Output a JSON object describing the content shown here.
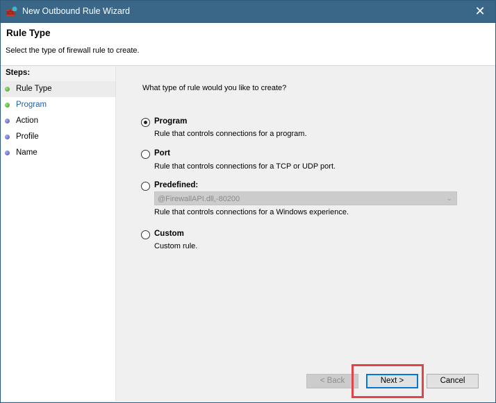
{
  "window": {
    "title": "New Outbound Rule Wizard",
    "app_icon": "firewall-wizard-icon",
    "close_icon": "close-icon",
    "close_glyph": "✕"
  },
  "header": {
    "title": "Rule Type",
    "subtitle": "Select the type of firewall rule to create."
  },
  "steps": {
    "heading": "Steps:",
    "items": [
      {
        "label": "Rule Type",
        "state": "current",
        "dot_color": "#4caf3a"
      },
      {
        "label": "Program",
        "state": "link",
        "dot_color": "#4caf3a"
      },
      {
        "label": "Action",
        "state": "pending",
        "dot_color": "#5b5fc7"
      },
      {
        "label": "Profile",
        "state": "pending",
        "dot_color": "#5b5fc7"
      },
      {
        "label": "Name",
        "state": "pending",
        "dot_color": "#5b5fc7"
      }
    ]
  },
  "main": {
    "question": "What type of rule would you like to create?",
    "options": [
      {
        "label": "Program",
        "description": "Rule that controls connections for a program.",
        "checked": true
      },
      {
        "label": "Port",
        "description": "Rule that controls connections for a TCP or UDP port.",
        "checked": false
      },
      {
        "label": "Predefined:",
        "description": "Rule that controls connections for a Windows experience.",
        "checked": false,
        "combo_value": "@FirewallAPI.dll,-80200",
        "combo_disabled": true
      },
      {
        "label": "Custom",
        "description": "Custom rule.",
        "checked": false
      }
    ],
    "chevron_glyph": "⌄"
  },
  "buttons": {
    "back": "< Back",
    "next": "Next >",
    "cancel": "Cancel"
  },
  "colors": {
    "titlebar": "#3a6688",
    "highlight": "#e0434a",
    "focus": "#0078d7"
  }
}
